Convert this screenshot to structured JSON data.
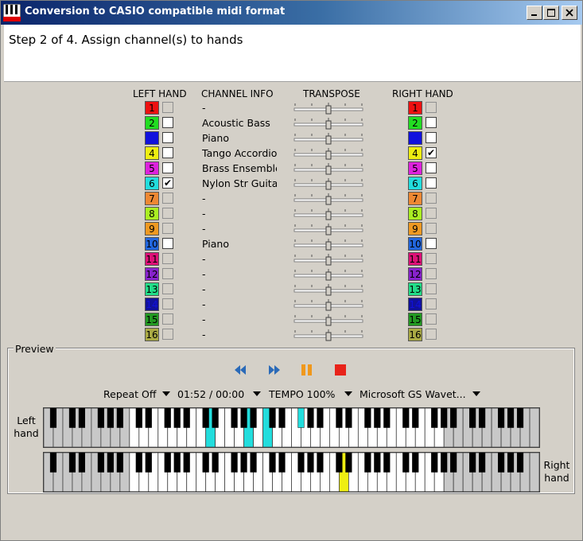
{
  "window": {
    "title": "Conversion to CASIO compatible midi format",
    "controls": [
      "minimize",
      "maximize",
      "close"
    ]
  },
  "header": {
    "step_text": "Step 2 of 4. Assign channel(s) to hands"
  },
  "columns": {
    "left_hand": "LEFT HAND",
    "channel_info": "CHANNEL INFO",
    "transpose": "TRANSPOSE",
    "right_hand": "RIGHT HAND"
  },
  "channels": [
    {
      "num": "1",
      "color": "#ee1111",
      "info": "-",
      "enabled": false,
      "left": false,
      "right": false
    },
    {
      "num": "2",
      "color": "#22dd22",
      "info": "Acoustic Bass",
      "enabled": true,
      "left": false,
      "right": false
    },
    {
      "num": "3",
      "color": "#1111dd",
      "info": "Piano",
      "enabled": true,
      "left": false,
      "right": false
    },
    {
      "num": "4",
      "color": "#eeee11",
      "info": "Tango Accordion",
      "enabled": true,
      "left": false,
      "right": true
    },
    {
      "num": "5",
      "color": "#dd22dd",
      "info": "Brass Ensemble",
      "enabled": true,
      "left": false,
      "right": false
    },
    {
      "num": "6",
      "color": "#22dddd",
      "info": "Nylon Str Guitar",
      "enabled": true,
      "left": true,
      "right": false
    },
    {
      "num": "7",
      "color": "#ee8833",
      "info": "-",
      "enabled": false,
      "left": false,
      "right": false
    },
    {
      "num": "8",
      "color": "#aaee22",
      "info": "-",
      "enabled": false,
      "left": false,
      "right": false
    },
    {
      "num": "9",
      "color": "#ee9922",
      "info": "-",
      "enabled": false,
      "left": false,
      "right": false
    },
    {
      "num": "10",
      "color": "#2266dd",
      "info": "Piano",
      "enabled": true,
      "left": false,
      "right": false
    },
    {
      "num": "11",
      "color": "#dd1177",
      "info": "-",
      "enabled": false,
      "left": false,
      "right": false
    },
    {
      "num": "12",
      "color": "#8822cc",
      "info": "-",
      "enabled": false,
      "left": false,
      "right": false
    },
    {
      "num": "13",
      "color": "#22dd88",
      "info": "-",
      "enabled": false,
      "left": false,
      "right": false
    },
    {
      "num": "14",
      "color": "#111199",
      "info": "-",
      "enabled": false,
      "left": false,
      "right": false
    },
    {
      "num": "15",
      "color": "#229922",
      "info": "-",
      "enabled": false,
      "left": false,
      "right": false
    },
    {
      "num": "16",
      "color": "#aaaa44",
      "info": "-",
      "enabled": false,
      "left": false,
      "right": false
    }
  ],
  "preview": {
    "label": "Preview",
    "buttons": [
      "rewind",
      "fast-forward",
      "pause",
      "stop"
    ],
    "repeat": "Repeat Off",
    "time": "01:52 / 00:00",
    "tempo": "TEMPO 100%",
    "device": "Microsoft GS Wavet...",
    "left_hand_label": "Left hand",
    "right_hand_label": "Right hand",
    "left_highlight_color": "#22dddd",
    "right_highlight_color": "#eeee11"
  }
}
